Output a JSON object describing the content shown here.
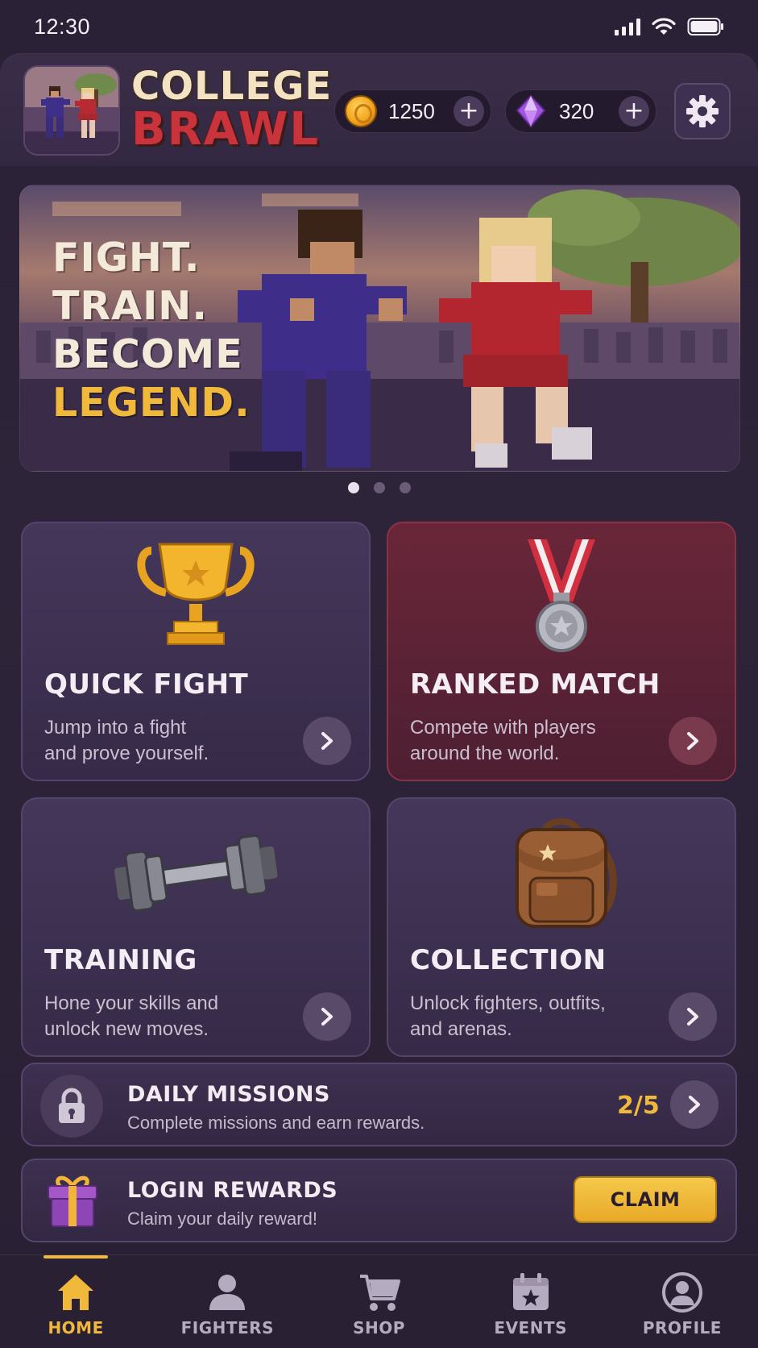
{
  "status_bar": {
    "time": "12:30"
  },
  "header": {
    "logo_line1": "COLLEGE",
    "logo_line2": "BRAWL",
    "coins": "1250",
    "gems": "320",
    "icons": {
      "coin": "coin-icon",
      "gem": "gem-icon",
      "settings": "gear-icon",
      "add": "plus-icon"
    }
  },
  "hero": {
    "lines": [
      "FIGHT.",
      "TRAIN.",
      "BECOME",
      "LEGEND."
    ],
    "carousel": {
      "pages": 3,
      "active": 1
    }
  },
  "modes": [
    {
      "title": "QUICK FIGHT",
      "desc_line1": "Jump into a fight",
      "desc_line2": "and prove yourself.",
      "icon": "trophy-icon"
    },
    {
      "title": "RANKED MATCH",
      "desc_line1": "Compete with players",
      "desc_line2": "around the world.",
      "icon": "medal-icon"
    },
    {
      "title": "TRAINING",
      "desc_line1": "Hone your skills and",
      "desc_line2": "unlock new moves.",
      "icon": "dumbbell-icon"
    },
    {
      "title": "COLLECTION",
      "desc_line1": "Unlock fighters, outfits,",
      "desc_line2": "and arenas.",
      "icon": "backpack-icon"
    }
  ],
  "daily_missions": {
    "title": "DAILY MISSIONS",
    "desc": "Complete missions and earn rewards.",
    "progress": "2/5",
    "progress_done": 2,
    "progress_total": 5
  },
  "login_rewards": {
    "title": "LOGIN REWARDS",
    "desc": "Claim your daily reward!",
    "button": "CLAIM"
  },
  "nav": [
    {
      "label": "HOME",
      "icon": "home-icon",
      "active": true
    },
    {
      "label": "FIGHTERS",
      "icon": "person-icon",
      "active": false
    },
    {
      "label": "SHOP",
      "icon": "cart-icon",
      "active": false
    },
    {
      "label": "EVENTS",
      "icon": "calendar-icon",
      "active": false
    },
    {
      "label": "PROFILE",
      "icon": "profile-icon",
      "active": false
    }
  ],
  "colors": {
    "accent": "#f1b93b",
    "brand_red": "#c8333c",
    "background": "#2a2034"
  }
}
